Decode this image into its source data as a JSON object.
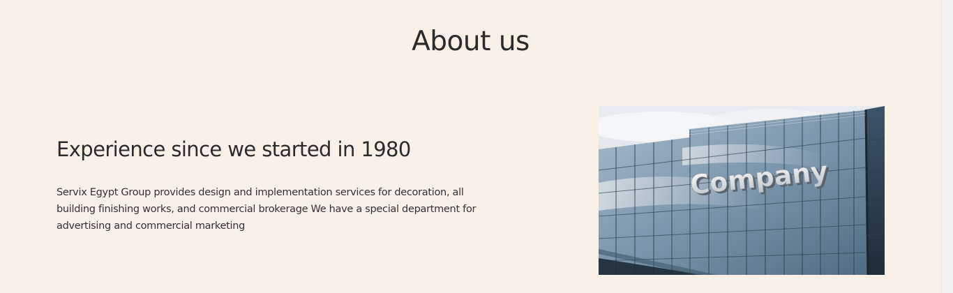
{
  "section": {
    "title": "About us"
  },
  "about": {
    "heading": "Experience since we started in 1980",
    "description": "Servix Egypt Group provides design and implementation services for decoration, all building finishing works, and commercial brokerage We have a special department for advertising and commercial marketing"
  },
  "photo": {
    "sign_text": "Company"
  },
  "colors": {
    "background": "#f9f0e8",
    "text": "#2b2b2b"
  }
}
